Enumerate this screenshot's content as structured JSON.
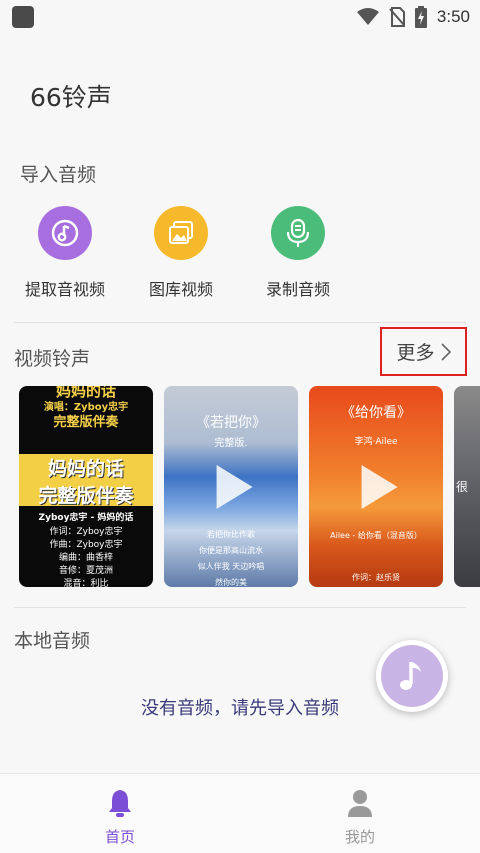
{
  "status_bar": {
    "time": "3:50"
  },
  "app_title": "66铃声",
  "import_section": {
    "title": "导入音频",
    "items": [
      {
        "label": "提取音视频",
        "icon": "music-note-disc-icon",
        "color": "#a76ee0"
      },
      {
        "label": "图库视频",
        "icon": "gallery-icon",
        "color": "#f6b92b"
      },
      {
        "label": "录制音频",
        "icon": "microphone-icon",
        "color": "#4cbc7a"
      }
    ]
  },
  "video_section": {
    "title": "视频铃声",
    "more_label": "更多",
    "cards": [
      {
        "top_text": "妈妈的话",
        "singer_line": "演唱：Zyboy忠宇",
        "tag": "完整版伴奏",
        "big_title_1": "妈妈的话",
        "big_title_2": "完整版伴奏",
        "credits": [
          "Zyboy忠宇 - 妈妈的话",
          "作词：Zyboy忠宇",
          "作曲：Zyboy忠宇",
          "编曲：曲香梓",
          "音修：夏茂洲",
          "混音：利比"
        ]
      },
      {
        "title": "《若把你》",
        "subtitle": "完整版.",
        "lyrics": [
          "若把你比作歌",
          "你便是那高山流水",
          "似人伴我 天边吟唱",
          "然你的美"
        ]
      },
      {
        "title": "《给你看》",
        "singer_line": "李鸿·Ailee",
        "credits": [
          "Ailee - 给你看（混音版）",
          "作词：赵乐贤"
        ]
      },
      {
        "partial_text": "很"
      }
    ]
  },
  "local_section": {
    "title": "本地音频",
    "empty_text": "没有音频，请先导入音频"
  },
  "bottom_nav": {
    "items": [
      {
        "label": "首页",
        "icon": "bell-icon",
        "active": true
      },
      {
        "label": "我的",
        "icon": "person-icon",
        "active": false
      }
    ],
    "active_color": "#7b4fd6",
    "inactive_color": "#999999"
  }
}
